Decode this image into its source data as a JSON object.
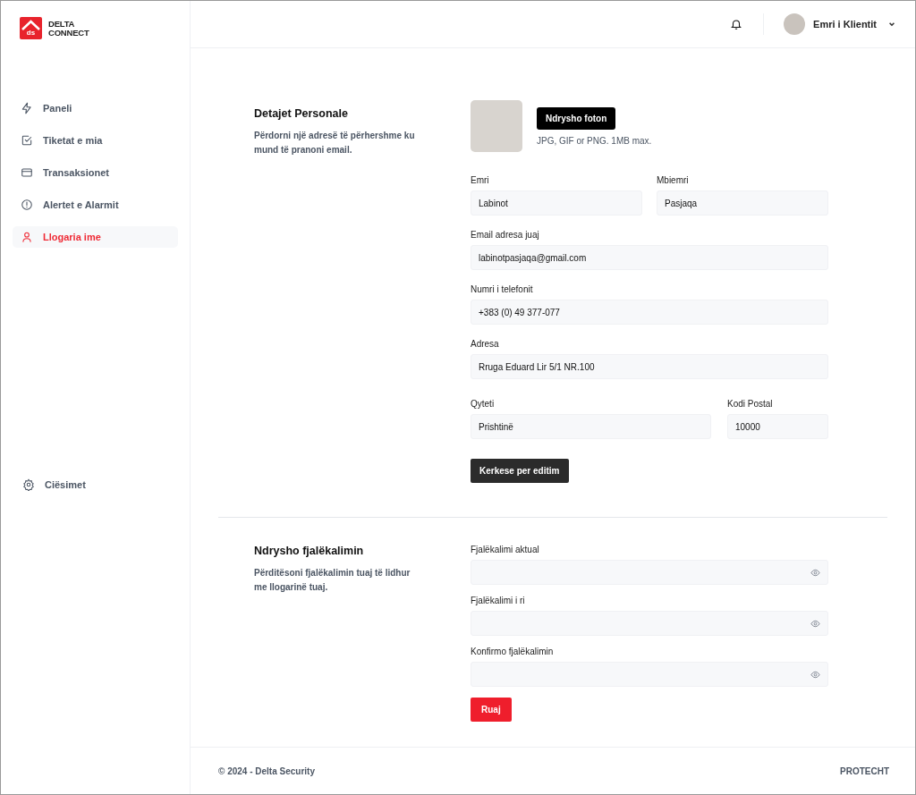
{
  "logo": {
    "mark": "ds",
    "line1": "DELTA",
    "line2": "CONNECT"
  },
  "sidebar": {
    "items": [
      {
        "label": "Paneli",
        "selected": false
      },
      {
        "label": "Tiketat e mia",
        "selected": false
      },
      {
        "label": "Transaksionet",
        "selected": false
      },
      {
        "label": "Alertet e Alarmit",
        "selected": false
      },
      {
        "label": "Llogaria ime",
        "selected": true
      }
    ],
    "settings": {
      "label": "Ciësimet"
    }
  },
  "header": {
    "user_name": "Emri i Klientit"
  },
  "personal": {
    "title": "Detajet Personale",
    "description": "Përdorni një adresë të përhershme ku mund të pranoni email.",
    "photo_button": "Ndrysho foton",
    "photo_hint": "JPG, GIF or PNG. 1MB max.",
    "rows": [
      {
        "fields": [
          {
            "label": "Emri",
            "value": "Labinot"
          },
          {
            "label": "Mbiemri",
            "value": "Pasjaqa"
          }
        ]
      },
      {
        "fields": [
          {
            "label": "Email adresa juaj",
            "value": "labinotpasjaqa@gmail.com"
          }
        ]
      },
      {
        "fields": [
          {
            "label": "Numri i telefonit",
            "value": "+383 (0) 49 377-077"
          }
        ]
      },
      {
        "fields": [
          {
            "label": "Adresa",
            "value": "Rruga Eduard Lir 5/1 NR.100"
          }
        ]
      },
      {
        "fields": [
          {
            "label": "Qyteti",
            "value": "Prishtinë"
          },
          {
            "label": "Kodi Postal",
            "value": "10000"
          }
        ]
      }
    ],
    "submit": "Kerkese per editim"
  },
  "password": {
    "title": "Ndrysho fjalëkalimin",
    "description": "Përditësoni fjalëkalimin tuaj të lidhur me llogarinë tuaj.",
    "fields": [
      {
        "label": "Fjalëkalimi aktual"
      },
      {
        "label": "Fjalëkalimi i ri"
      },
      {
        "label": "Konfirmo fjalëkalimin"
      }
    ],
    "submit": "Ruaj"
  },
  "footer": {
    "copyright": "© 2024 - Delta Security",
    "brand": "PROTECHT"
  }
}
